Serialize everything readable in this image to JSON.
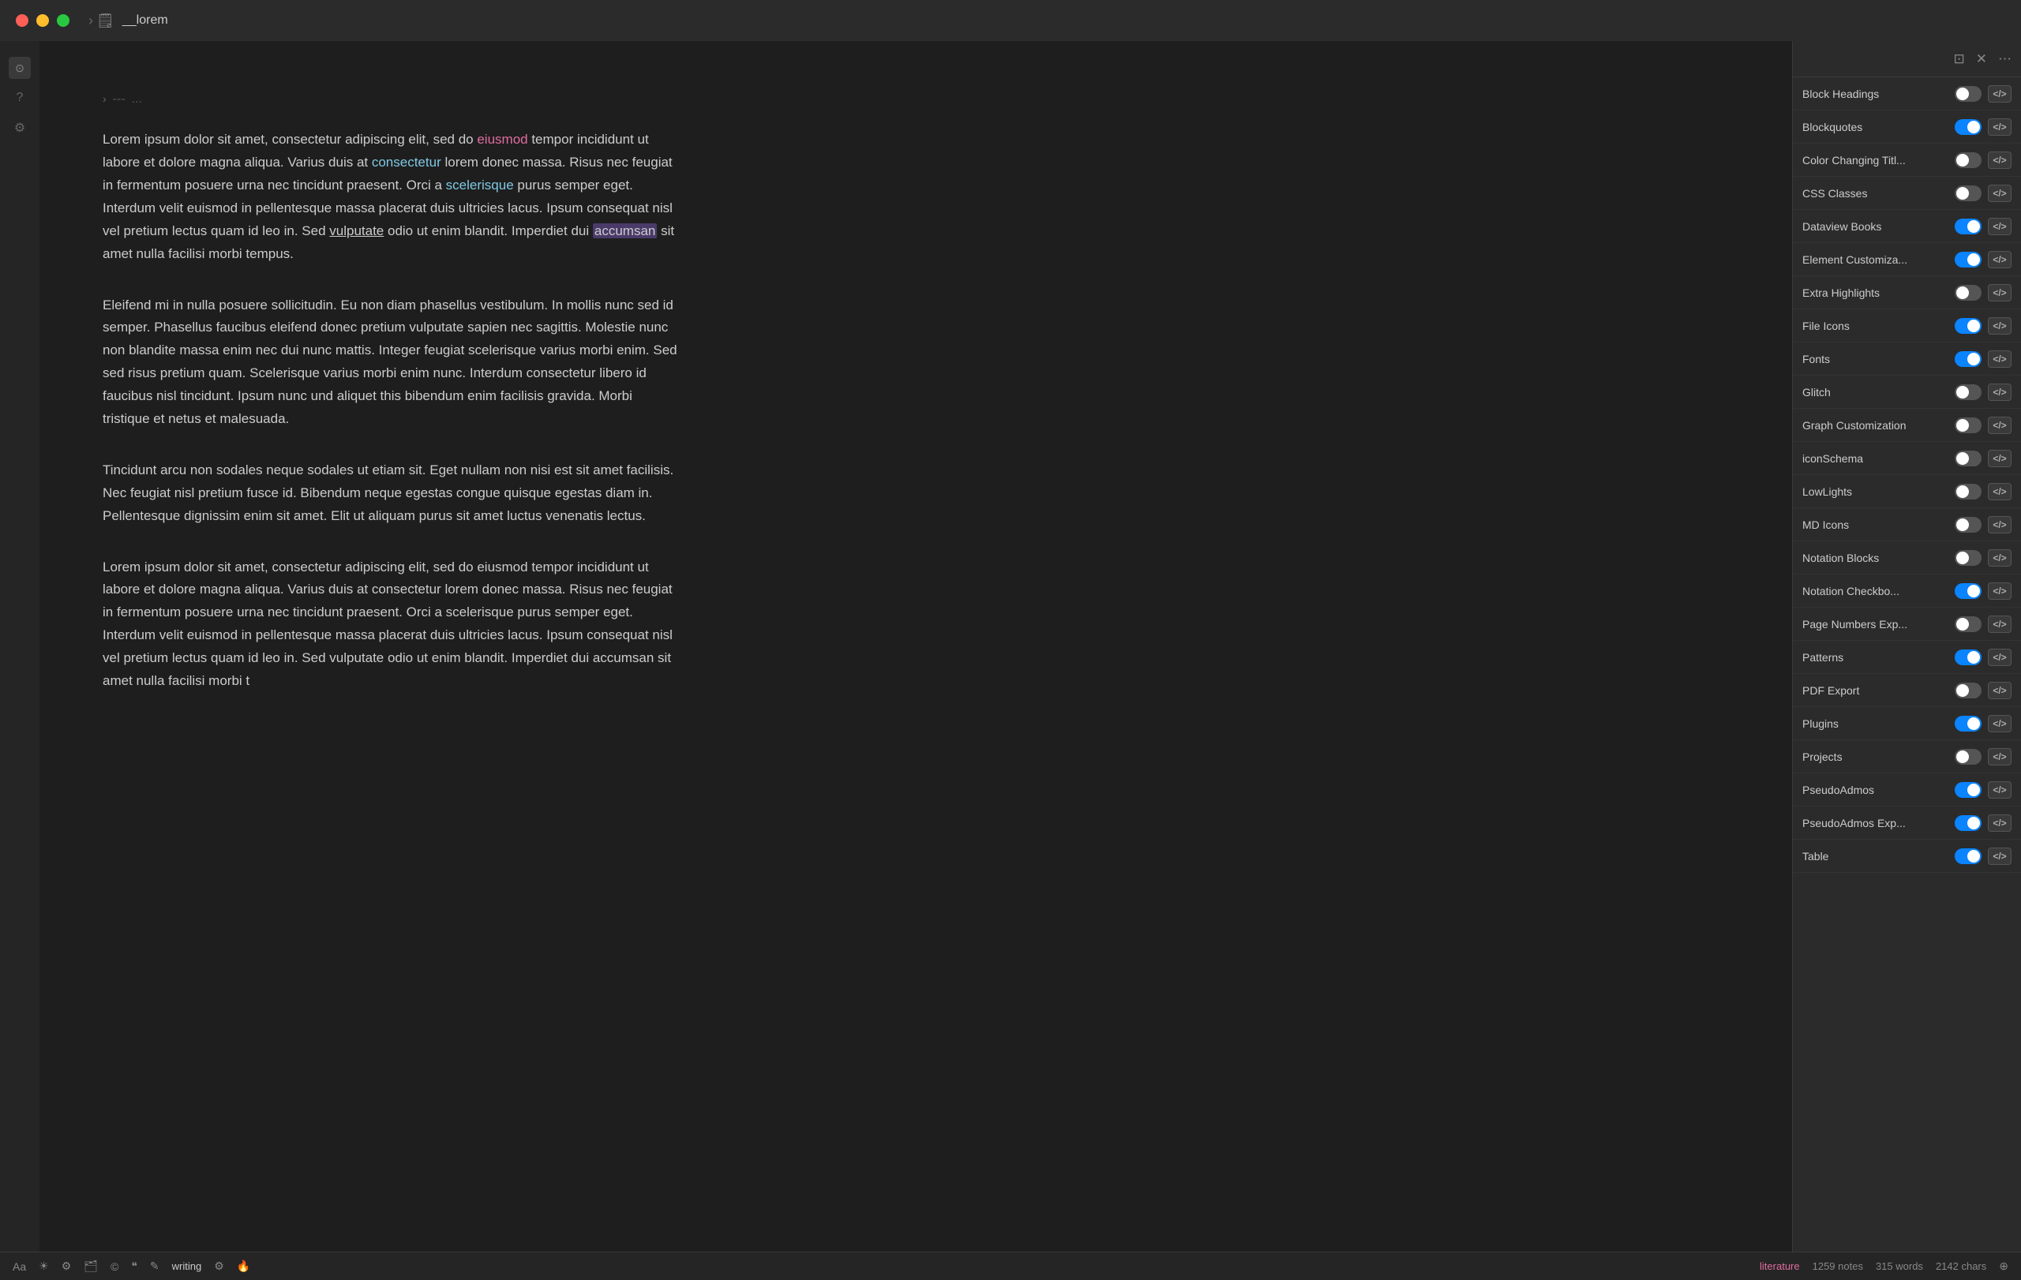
{
  "titlebar": {
    "file_title": "__lorem",
    "nav_arrow": "›"
  },
  "editor": {
    "collapsed_label": "---",
    "collapsed_dots": "...",
    "paragraphs": [
      {
        "id": "p1",
        "parts": [
          {
            "text": "Lorem ipsum dolor sit amet, consectetur adipiscing elit, sed do ",
            "style": "normal"
          },
          {
            "text": "eiusmod",
            "style": "highlight-pink"
          },
          {
            "text": " tempor incididunt ut labore et dolore magna aliqua. Varius duis at ",
            "style": "normal"
          },
          {
            "text": "consectetur",
            "style": "highlight-link"
          },
          {
            "text": " lorem donec massa. Risus nec feugiat in fermentum posuere urna nec tincidunt praesent. Orci a ",
            "style": "normal"
          },
          {
            "text": "scelerisque",
            "style": "highlight-link"
          },
          {
            "text": " purus semper eget. Interdum velit euismod in pellentesque massa placerat duis ultricies lacus. Ipsum consequat nisl vel pretium lectus quam id leo in. Sed ",
            "style": "normal"
          },
          {
            "text": "vulputate",
            "style": "highlight-underline"
          },
          {
            "text": " odio ut enim blandit. Imperdiet dui ",
            "style": "normal"
          },
          {
            "text": "accumsan",
            "style": "highlight-bg"
          },
          {
            "text": " sit amet nulla facilisi morbi tempus.",
            "style": "normal"
          }
        ]
      },
      {
        "id": "p2",
        "parts": [
          {
            "text": "Eleifend mi in nulla posuere sollicitudin. Eu non diam phasellus vestibulum. In mollis nunc sed id semper. Phasellus faucibus eleifend donec pretium vulputate sapien nec sagittis. Molestie nunc non blandite massa enim nec dui nunc mattis. Integer feugiat scelerisque varius morbi enim. Sed sed risus pretium quam. Scelerisque varius morbi enim nunc. Interdum consectetur libero id faucibus nisl tincidunt. Ipsum nunc und aliquet this bibendum enim facilisis gravida. Morbi tristique et netus et malesuada.",
            "style": "normal"
          }
        ]
      },
      {
        "id": "p3",
        "parts": [
          {
            "text": "Tincidunt arcu non sodales neque sodales ut etiam sit. Eget nullam non nisi est sit amet facilisis. Nec feugiat nisl pretium fusce id. Bibendum neque egestas congue quisque egestas diam in. Pellentesque dignissim enim sit amet. Elit ut aliquam purus sit amet luctus venenatis lectus.",
            "style": "normal"
          }
        ]
      },
      {
        "id": "p4",
        "parts": [
          {
            "text": "Lorem ipsum dolor sit amet, consectetur adipiscing elit, sed do eiusmod tempor incididunt ut labore et dolore magna aliqua. Varius duis at consectetur lorem donec massa. Risus nec feugiat in fermentum posuere urna nec tincidunt praesent. Orci a scelerisque purus semper eget. Interdum velit euismod in pellentesque massa placerat duis ultricies lacus. Ipsum consequat nisl vel pretium lectus quam id leo in. Sed vulputate odio ut enim blandit. Imperdiet dui accumsan sit amet nulla facilisi morbi t",
            "style": "normal"
          }
        ]
      }
    ]
  },
  "right_panel": {
    "plugins": [
      {
        "name": "Block Headings",
        "toggle": "off",
        "id": "block-headings"
      },
      {
        "name": "Blockquotes",
        "toggle": "on",
        "id": "blockquotes"
      },
      {
        "name": "Color Changing Titl...",
        "toggle": "off",
        "id": "color-changing"
      },
      {
        "name": "CSS Classes",
        "toggle": "off",
        "id": "css-classes"
      },
      {
        "name": "Dataview Books",
        "toggle": "on",
        "id": "dataview-books"
      },
      {
        "name": "Element Customiza...",
        "toggle": "on",
        "id": "element-customiza"
      },
      {
        "name": "Extra Highlights",
        "toggle": "off",
        "id": "extra-highlights"
      },
      {
        "name": "File Icons",
        "toggle": "on",
        "id": "file-icons"
      },
      {
        "name": "Fonts",
        "toggle": "on",
        "id": "fonts"
      },
      {
        "name": "Glitch",
        "toggle": "off",
        "id": "glitch"
      },
      {
        "name": "Graph Customization",
        "toggle": "off",
        "id": "graph-customization"
      },
      {
        "name": "iconSchema",
        "toggle": "off",
        "id": "iconschema"
      },
      {
        "name": "LowLights",
        "toggle": "off",
        "id": "lowlights"
      },
      {
        "name": "MD Icons",
        "toggle": "off",
        "id": "md-icons"
      },
      {
        "name": "Notation Blocks",
        "toggle": "off",
        "id": "notation-blocks"
      },
      {
        "name": "Notation Checkbo...",
        "toggle": "on",
        "id": "notation-checkbo"
      },
      {
        "name": "Page Numbers Exp...",
        "toggle": "off",
        "id": "page-numbers"
      },
      {
        "name": "Patterns",
        "toggle": "on",
        "id": "patterns"
      },
      {
        "name": "PDF Export",
        "toggle": "off",
        "id": "pdf-export"
      },
      {
        "name": "Plugins",
        "toggle": "on",
        "id": "plugins"
      },
      {
        "name": "Projects",
        "toggle": "off",
        "id": "projects"
      },
      {
        "name": "PseudoAdmos",
        "toggle": "on",
        "id": "pseudoadmos"
      },
      {
        "name": "PseudoAdmos Exp...",
        "toggle": "on",
        "id": "pseudoadmos-exp"
      },
      {
        "name": "Table",
        "toggle": "on",
        "id": "table"
      }
    ]
  },
  "statusbar": {
    "icons": [
      "Aa",
      "☀",
      "⚙",
      "🗂",
      "©",
      "❝",
      "✎"
    ],
    "writing_mode": "writing",
    "tag": "literature",
    "notes_count": "1259 notes",
    "words_count": "315 words",
    "chars_count": "2142 chars",
    "end_icon": "⊕"
  }
}
